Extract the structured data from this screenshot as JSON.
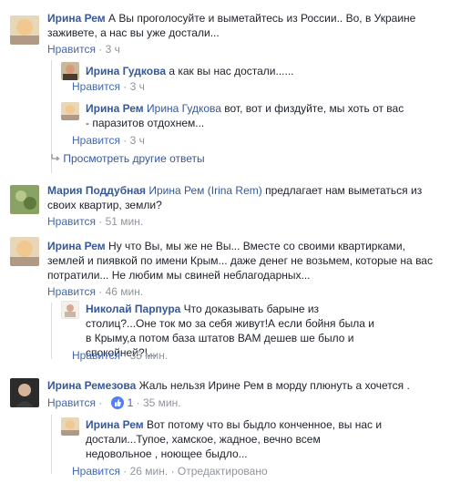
{
  "comments": [
    {
      "author": "Ирина Рем",
      "text": " А Вы проголосуйте и выметайтесь из России.. Во, в Украине заживете, а нас вы уже достали...",
      "like": "Нравится",
      "time": "3 ч"
    },
    {
      "author": "Ирина Гудкова",
      "text": " а как вы нас достали......",
      "like": "Нравится",
      "time": "3 ч"
    },
    {
      "author": "Ирина Рем",
      "mention": " Ирина Гудкова",
      "text": " вот, вот и физдуйте, мы хоть от вас - паразитов отдохнем...",
      "like": "Нравится",
      "time": "3 ч"
    },
    {
      "author": "Мария Поддубная",
      "mention": " Ирина Рем (Irina Rem)",
      "text": " предлагает нам выметаться из своих квартир, земли?",
      "like": "Нравится",
      "time": "51 мин."
    },
    {
      "author": "Ирина Рем",
      "text": " Ну что Вы, мы же не Вы... Вместе со своими квартирками, землей и пиявкой по имени Крым... даже денег не возьмем, которые на вас потратили... Не любим мы свиней неблагодарных...",
      "like": "Нравится",
      "time": "46 мин."
    },
    {
      "author": "Николай Парпура",
      "text": " Что доказывать барыне из столиц?...Оне ток мо за себя живут!А если бойня была и в Крыму,а потом база штатов ВАМ дешев ше было и спокойней?!...",
      "like": "Нравится",
      "time": "35 мин."
    },
    {
      "author": "Ирина Ремезова",
      "text": " Жаль нельзя Ирине Рем в морду плюнуть а хочется .",
      "like": "Нравится",
      "time": "35 мин.",
      "reactions": "1"
    },
    {
      "author": "Ирина Рем",
      "text": " Вот потому что вы быдло конченное, вы нас и достали...Тупое, хамское, жадное, вечно всем недовольное , ноющее быдло...",
      "like": "Нравится",
      "time": "26 мин.",
      "edited": "Отредактировано"
    }
  ],
  "more_replies": "Просмотреть другие ответы",
  "separator": " · "
}
